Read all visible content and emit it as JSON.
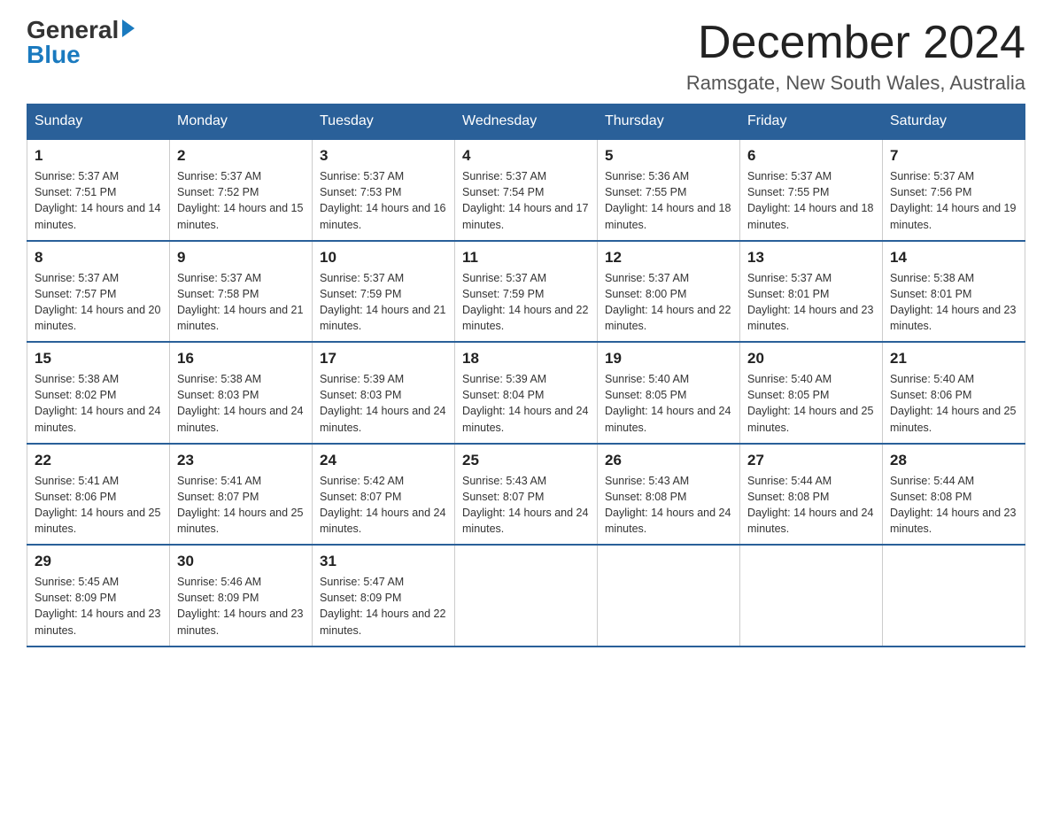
{
  "logo": {
    "general": "General",
    "blue": "Blue"
  },
  "title": "December 2024",
  "subtitle": "Ramsgate, New South Wales, Australia",
  "days_of_week": [
    "Sunday",
    "Monday",
    "Tuesday",
    "Wednesday",
    "Thursday",
    "Friday",
    "Saturday"
  ],
  "weeks": [
    [
      {
        "day": "1",
        "sunrise": "Sunrise: 5:37 AM",
        "sunset": "Sunset: 7:51 PM",
        "daylight": "Daylight: 14 hours and 14 minutes."
      },
      {
        "day": "2",
        "sunrise": "Sunrise: 5:37 AM",
        "sunset": "Sunset: 7:52 PM",
        "daylight": "Daylight: 14 hours and 15 minutes."
      },
      {
        "day": "3",
        "sunrise": "Sunrise: 5:37 AM",
        "sunset": "Sunset: 7:53 PM",
        "daylight": "Daylight: 14 hours and 16 minutes."
      },
      {
        "day": "4",
        "sunrise": "Sunrise: 5:37 AM",
        "sunset": "Sunset: 7:54 PM",
        "daylight": "Daylight: 14 hours and 17 minutes."
      },
      {
        "day": "5",
        "sunrise": "Sunrise: 5:36 AM",
        "sunset": "Sunset: 7:55 PM",
        "daylight": "Daylight: 14 hours and 18 minutes."
      },
      {
        "day": "6",
        "sunrise": "Sunrise: 5:37 AM",
        "sunset": "Sunset: 7:55 PM",
        "daylight": "Daylight: 14 hours and 18 minutes."
      },
      {
        "day": "7",
        "sunrise": "Sunrise: 5:37 AM",
        "sunset": "Sunset: 7:56 PM",
        "daylight": "Daylight: 14 hours and 19 minutes."
      }
    ],
    [
      {
        "day": "8",
        "sunrise": "Sunrise: 5:37 AM",
        "sunset": "Sunset: 7:57 PM",
        "daylight": "Daylight: 14 hours and 20 minutes."
      },
      {
        "day": "9",
        "sunrise": "Sunrise: 5:37 AM",
        "sunset": "Sunset: 7:58 PM",
        "daylight": "Daylight: 14 hours and 21 minutes."
      },
      {
        "day": "10",
        "sunrise": "Sunrise: 5:37 AM",
        "sunset": "Sunset: 7:59 PM",
        "daylight": "Daylight: 14 hours and 21 minutes."
      },
      {
        "day": "11",
        "sunrise": "Sunrise: 5:37 AM",
        "sunset": "Sunset: 7:59 PM",
        "daylight": "Daylight: 14 hours and 22 minutes."
      },
      {
        "day": "12",
        "sunrise": "Sunrise: 5:37 AM",
        "sunset": "Sunset: 8:00 PM",
        "daylight": "Daylight: 14 hours and 22 minutes."
      },
      {
        "day": "13",
        "sunrise": "Sunrise: 5:37 AM",
        "sunset": "Sunset: 8:01 PM",
        "daylight": "Daylight: 14 hours and 23 minutes."
      },
      {
        "day": "14",
        "sunrise": "Sunrise: 5:38 AM",
        "sunset": "Sunset: 8:01 PM",
        "daylight": "Daylight: 14 hours and 23 minutes."
      }
    ],
    [
      {
        "day": "15",
        "sunrise": "Sunrise: 5:38 AM",
        "sunset": "Sunset: 8:02 PM",
        "daylight": "Daylight: 14 hours and 24 minutes."
      },
      {
        "day": "16",
        "sunrise": "Sunrise: 5:38 AM",
        "sunset": "Sunset: 8:03 PM",
        "daylight": "Daylight: 14 hours and 24 minutes."
      },
      {
        "day": "17",
        "sunrise": "Sunrise: 5:39 AM",
        "sunset": "Sunset: 8:03 PM",
        "daylight": "Daylight: 14 hours and 24 minutes."
      },
      {
        "day": "18",
        "sunrise": "Sunrise: 5:39 AM",
        "sunset": "Sunset: 8:04 PM",
        "daylight": "Daylight: 14 hours and 24 minutes."
      },
      {
        "day": "19",
        "sunrise": "Sunrise: 5:40 AM",
        "sunset": "Sunset: 8:05 PM",
        "daylight": "Daylight: 14 hours and 24 minutes."
      },
      {
        "day": "20",
        "sunrise": "Sunrise: 5:40 AM",
        "sunset": "Sunset: 8:05 PM",
        "daylight": "Daylight: 14 hours and 25 minutes."
      },
      {
        "day": "21",
        "sunrise": "Sunrise: 5:40 AM",
        "sunset": "Sunset: 8:06 PM",
        "daylight": "Daylight: 14 hours and 25 minutes."
      }
    ],
    [
      {
        "day": "22",
        "sunrise": "Sunrise: 5:41 AM",
        "sunset": "Sunset: 8:06 PM",
        "daylight": "Daylight: 14 hours and 25 minutes."
      },
      {
        "day": "23",
        "sunrise": "Sunrise: 5:41 AM",
        "sunset": "Sunset: 8:07 PM",
        "daylight": "Daylight: 14 hours and 25 minutes."
      },
      {
        "day": "24",
        "sunrise": "Sunrise: 5:42 AM",
        "sunset": "Sunset: 8:07 PM",
        "daylight": "Daylight: 14 hours and 24 minutes."
      },
      {
        "day": "25",
        "sunrise": "Sunrise: 5:43 AM",
        "sunset": "Sunset: 8:07 PM",
        "daylight": "Daylight: 14 hours and 24 minutes."
      },
      {
        "day": "26",
        "sunrise": "Sunrise: 5:43 AM",
        "sunset": "Sunset: 8:08 PM",
        "daylight": "Daylight: 14 hours and 24 minutes."
      },
      {
        "day": "27",
        "sunrise": "Sunrise: 5:44 AM",
        "sunset": "Sunset: 8:08 PM",
        "daylight": "Daylight: 14 hours and 24 minutes."
      },
      {
        "day": "28",
        "sunrise": "Sunrise: 5:44 AM",
        "sunset": "Sunset: 8:08 PM",
        "daylight": "Daylight: 14 hours and 23 minutes."
      }
    ],
    [
      {
        "day": "29",
        "sunrise": "Sunrise: 5:45 AM",
        "sunset": "Sunset: 8:09 PM",
        "daylight": "Daylight: 14 hours and 23 minutes."
      },
      {
        "day": "30",
        "sunrise": "Sunrise: 5:46 AM",
        "sunset": "Sunset: 8:09 PM",
        "daylight": "Daylight: 14 hours and 23 minutes."
      },
      {
        "day": "31",
        "sunrise": "Sunrise: 5:47 AM",
        "sunset": "Sunset: 8:09 PM",
        "daylight": "Daylight: 14 hours and 22 minutes."
      },
      null,
      null,
      null,
      null
    ]
  ]
}
